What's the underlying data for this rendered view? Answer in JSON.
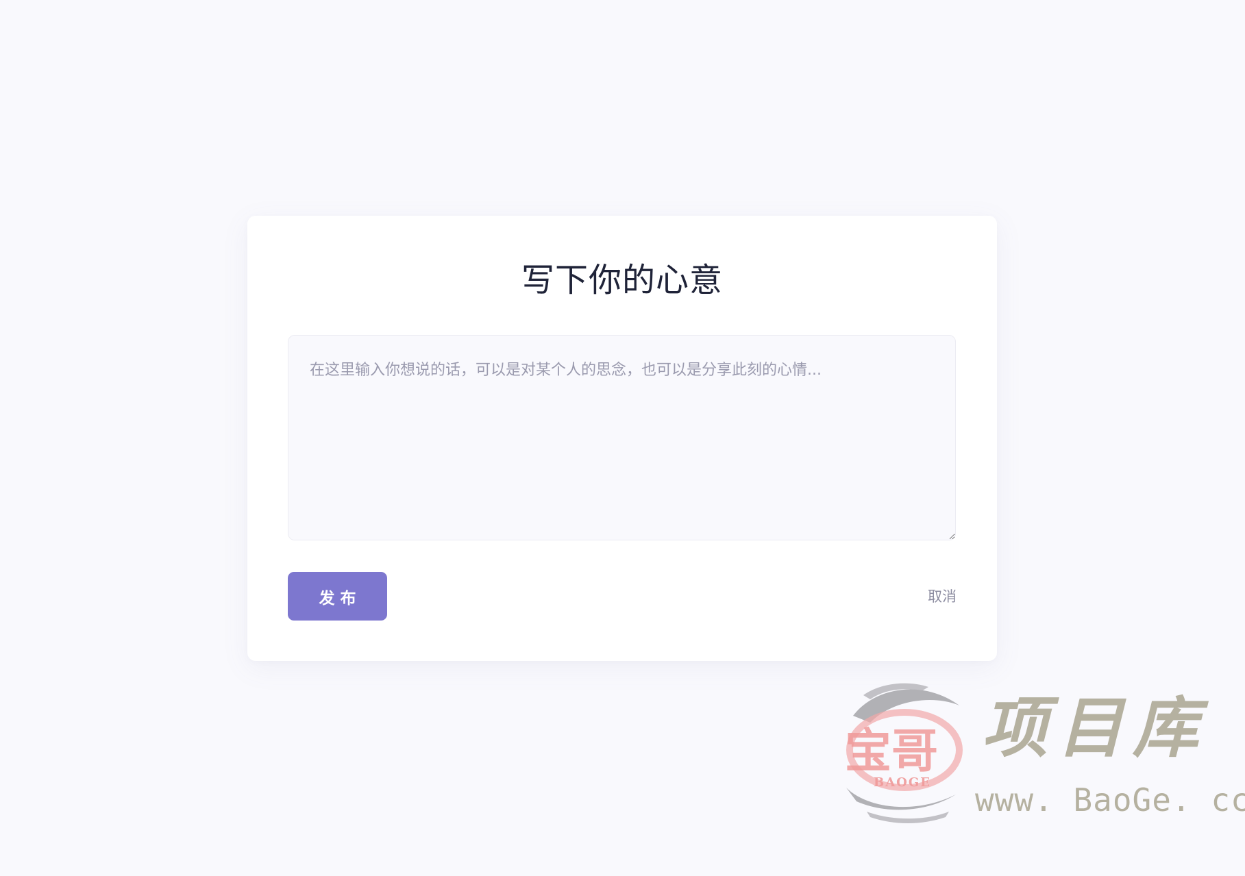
{
  "card": {
    "title": "写下你的心意",
    "editor": {
      "value": "",
      "placeholder": "在这里输入你想说的话，可以是对某个人的思念，也可以是分享此刻的心情..."
    },
    "publish_label": "发布",
    "cancel_label": "取消"
  },
  "colors": {
    "page_background": "#f9f9fd",
    "card_background": "#ffffff",
    "accent": "#7d77cf",
    "title_text": "#1f2338",
    "muted_text": "#8c8ca0"
  },
  "watermark": {
    "logo_text": "宝哥",
    "logo_subtext": "BAOGE",
    "title": "项目库",
    "url": "www. BaoGe. cc"
  }
}
